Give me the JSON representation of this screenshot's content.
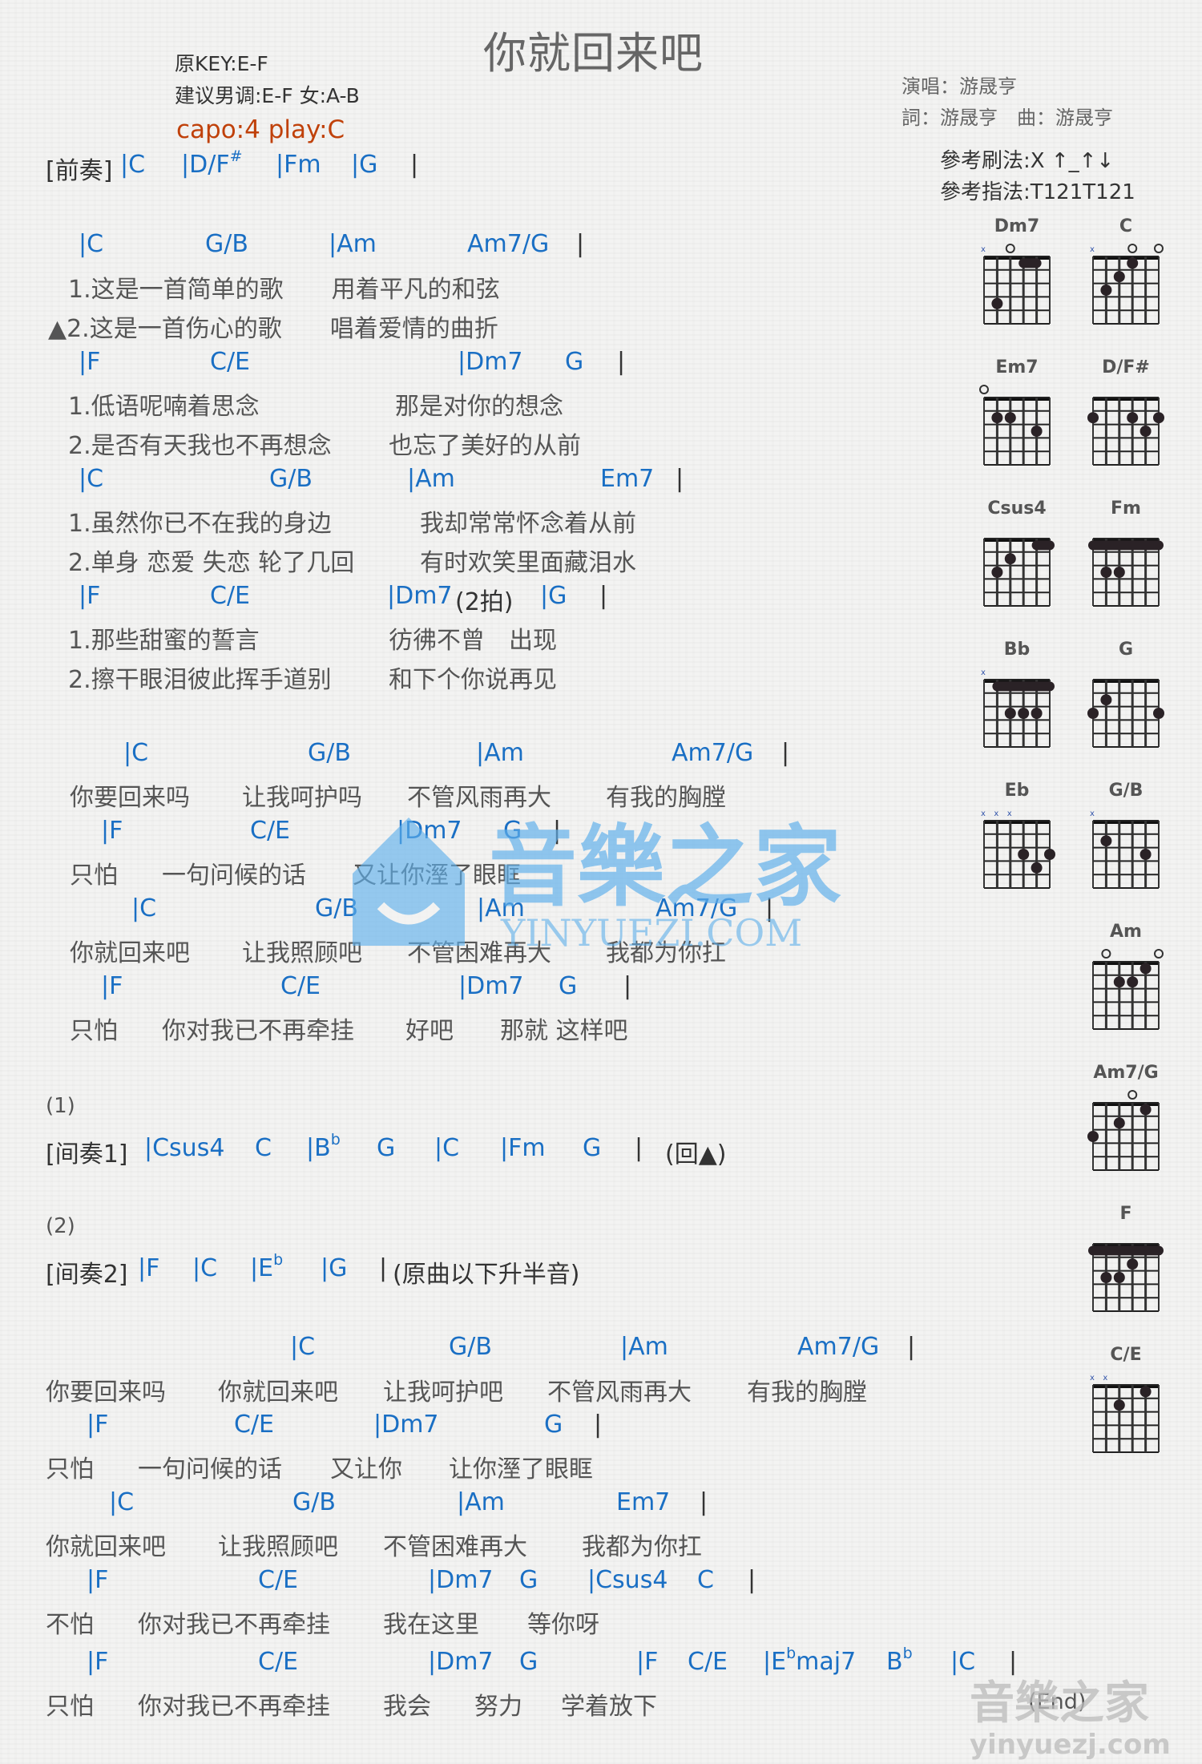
{
  "header": {
    "title": "你就回来吧",
    "original_key": "原KEY:E-F",
    "suggested_key": "建议男调:E-F 女:A-B",
    "capo": "capo:4 play:C",
    "singer": "演唱：游晟亨",
    "writers": "詞：游晟亨　曲：游晟亨",
    "strum": "參考刷法:X ↑_↑↓",
    "finger": "參考指法:T121T121"
  },
  "prelude": {
    "label": "[前奏]",
    "chords": [
      "|C",
      "|D/F",
      "#",
      "|Fm",
      "|G",
      "|"
    ]
  },
  "verse": {
    "c1": [
      "|C",
      "G/B",
      "|Am",
      "Am7/G",
      "|"
    ],
    "l1a": "1.这是一首简单的歌　　用着平凡的和弦",
    "l1b": "▲2.这是一首伤心的歌　　唱着爱情的曲折",
    "c2": [
      "|F",
      "C/E",
      "|Dm7",
      "G",
      "|"
    ],
    "l2a": "1.低语呢喃着思念",
    "l2a2": "那是对你的想念",
    "l2b": "2.是否有天我也不再想念",
    "l2b2": "也忘了美好的从前",
    "c3": [
      "|C",
      "G/B",
      "|Am",
      "Em7",
      "|"
    ],
    "l3a": "1.虽然你已不在我的身边",
    "l3a2": "我却常常怀念着从前",
    "l3b": "2.单身 恋爱 失恋 轮了几回",
    "l3b2": "有时欢笑里面藏泪水",
    "c4": [
      "|F",
      "C/E",
      "|Dm7",
      "(2拍)",
      "|G",
      "|"
    ],
    "l4a": "1.那些甜蜜的誓言",
    "l4a2": "彷彿不曾　出现",
    "l4b": "2.擦干眼泪彼此挥手道别",
    "l4b2": "和下个你说再见"
  },
  "chorus": {
    "c1": [
      "|C",
      "G/B",
      "|Am",
      "Am7/G",
      "|"
    ],
    "l1": [
      "你要回来吗",
      "让我呵护吗",
      "不管风雨再大",
      "有我的胸膛"
    ],
    "c2": [
      "|F",
      "C/E",
      "|Dm7",
      "G",
      "|"
    ],
    "l2": [
      "只怕",
      "一句问候的话",
      "又让你溼了眼眶"
    ],
    "c3": [
      "|C",
      "G/B",
      "|Am",
      "Am7/G",
      "|"
    ],
    "l3": [
      "你就回来吧",
      "让我照顾吧",
      "不管困难再大",
      "我都为你扛"
    ],
    "c4": [
      "|F",
      "C/E",
      "|Dm7",
      "G",
      "|"
    ],
    "l4": [
      "只怕",
      "你对我已不再牵挂",
      "好吧",
      "那就 这样吧"
    ]
  },
  "interlude1": {
    "num": "(1)",
    "label": "[间奏1]",
    "chords": [
      "|Csus4",
      "C",
      "|B",
      "b",
      "G",
      "|C",
      "|Fm",
      "G",
      "|"
    ],
    "back": "(回▲)"
  },
  "interlude2": {
    "num": "(2)",
    "label": "[间奏2]",
    "chords": [
      "|F",
      "|C",
      "|E",
      "b",
      "|G",
      "|"
    ],
    "note": "(原曲以下升半音)"
  },
  "final": {
    "c1": [
      "|C",
      "G/B",
      "|Am",
      "Am7/G",
      "|"
    ],
    "l1": [
      "你要回来吗",
      "你就回来吧",
      "让我呵护吧",
      "不管风雨再大",
      "有我的胸膛"
    ],
    "c2": [
      "|F",
      "C/E",
      "|Dm7",
      "G",
      "|"
    ],
    "l2": [
      "只怕",
      "一句问候的话",
      "又让你",
      "让你溼了眼眶"
    ],
    "c3": [
      "|C",
      "G/B",
      "|Am",
      "Em7",
      "|"
    ],
    "l3": [
      "你就回来吧",
      "让我照顾吧",
      "不管困难再大",
      "我都为你扛"
    ],
    "c4": [
      "|F",
      "C/E",
      "|Dm7",
      "G",
      "|Csus4",
      "C",
      "|"
    ],
    "l4": [
      "不怕",
      "你对我已不再牵挂",
      "我在这里",
      "等你呀"
    ],
    "c5": [
      "|F",
      "C/E",
      "|Dm7",
      "G",
      "|F",
      "C/E",
      "|E",
      "b",
      "maj7",
      "B",
      "b",
      "|C",
      "|"
    ],
    "l5": [
      "只怕",
      "你对我已不再牵挂",
      "我会",
      "努力",
      "学着放下"
    ],
    "end": "(End)"
  },
  "chord_diagrams": [
    {
      "name": "Dm7",
      "top": [
        "x",
        "",
        "o",
        "",
        "",
        ""
      ],
      "dots": [
        [
          4,
          2
        ]
      ],
      "barre": [
        [
          1,
          4,
          5
        ]
      ]
    },
    {
      "name": "C",
      "top": [
        "x",
        "",
        "",
        "o",
        "",
        "o"
      ],
      "dots": [
        [
          1,
          4
        ],
        [
          2,
          3
        ],
        [
          3,
          2
        ]
      ],
      "barre": []
    },
    {
      "name": "Em7",
      "top": [
        "o",
        "",
        "",
        "",
        "",
        ""
      ],
      "dots": [
        [
          2,
          2
        ],
        [
          2,
          3
        ],
        [
          3,
          5
        ]
      ],
      "barre": []
    },
    {
      "name": "D/F#",
      "top": [
        "",
        "",
        "",
        "",
        "",
        ""
      ],
      "dots": [
        [
          2,
          1
        ],
        [
          2,
          4
        ],
        [
          2,
          6
        ],
        [
          3,
          5
        ]
      ],
      "barre": []
    },
    {
      "name": "Csus4",
      "top": [
        "",
        "",
        "",
        "",
        "",
        ""
      ],
      "dots": [
        [
          2,
          3
        ],
        [
          3,
          2
        ]
      ],
      "barre": [
        [
          1,
          5,
          6
        ]
      ]
    },
    {
      "name": "Fm",
      "top": [
        "",
        "",
        "",
        "",
        "",
        ""
      ],
      "dots": [
        [
          3,
          2
        ],
        [
          3,
          3
        ]
      ],
      "barre": [
        [
          1,
          1,
          6
        ]
      ]
    },
    {
      "name": "Bb",
      "top": [
        "x",
        "",
        "",
        "",
        "",
        ""
      ],
      "dots": [
        [
          3,
          3
        ],
        [
          3,
          4
        ],
        [
          3,
          5
        ]
      ],
      "barre": [
        [
          1,
          2,
          6
        ]
      ]
    },
    {
      "name": "G",
      "top": [
        "",
        "",
        "",
        "",
        "",
        ""
      ],
      "dots": [
        [
          2,
          2
        ],
        [
          3,
          1
        ],
        [
          3,
          6
        ]
      ],
      "barre": []
    },
    {
      "name": "Eb",
      "top": [
        "x",
        "x",
        "x",
        "",
        "",
        ""
      ],
      "dots": [
        [
          3,
          4
        ],
        [
          3,
          6
        ],
        [
          4,
          5
        ]
      ],
      "barre": []
    },
    {
      "name": "G/B",
      "top": [
        "x",
        "",
        "",
        "",
        "",
        ""
      ],
      "dots": [
        [
          2,
          2
        ],
        [
          3,
          5
        ]
      ],
      "barre": []
    },
    {
      "name": "Am",
      "top": [
        "",
        "o",
        "",
        "",
        "",
        "o"
      ],
      "dots": [
        [
          1,
          5
        ],
        [
          2,
          3
        ],
        [
          2,
          4
        ]
      ],
      "barre": []
    },
    {
      "name": "Am7/G",
      "top": [
        "",
        "",
        "",
        "o",
        "",
        ""
      ],
      "dots": [
        [
          1,
          5
        ],
        [
          2,
          3
        ],
        [
          3,
          1
        ]
      ],
      "barre": []
    },
    {
      "name": "F",
      "top": [
        "",
        "",
        "",
        "",
        "",
        ""
      ],
      "dots": [
        [
          2,
          4
        ],
        [
          3,
          2
        ],
        [
          3,
          3
        ]
      ],
      "barre": [
        [
          1,
          1,
          6
        ]
      ]
    },
    {
      "name": "C/E",
      "top": [
        "x",
        "x",
        "",
        "",
        "",
        ""
      ],
      "dots": [
        [
          1,
          5
        ],
        [
          2,
          3
        ]
      ],
      "barre": []
    }
  ],
  "watermark": {
    "text_cn": "音樂之家",
    "text_en": "YINYUEZI.COM",
    "corner_cn": "音樂之家",
    "corner_en": "yinyuezj.com"
  },
  "colors": {
    "chord": "#1a6fc4",
    "lyric": "#555555",
    "capo": "#c0410a"
  }
}
